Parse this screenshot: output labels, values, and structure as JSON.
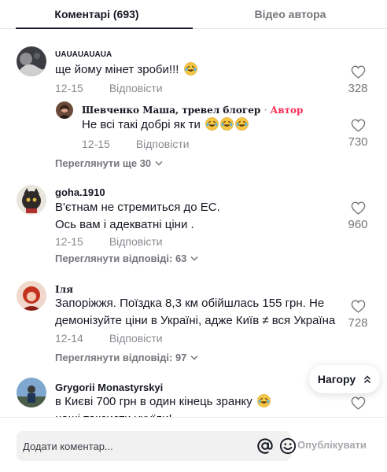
{
  "tabs": [
    {
      "label": "Коментарі (693)",
      "active": true
    },
    {
      "label": "Відео автора",
      "active": false
    }
  ],
  "comments": [
    {
      "user": "UAUAUAUAUA",
      "text": "ще йому мінет зроби!!!",
      "date": "12-15",
      "reply_label": "Відповісти",
      "likes": "328",
      "reply": {
        "user": "Шевченко Маша, тревел блогер",
        "separator": "·",
        "badge": "Автор",
        "text": "Не всі такі добрі як ти",
        "date": "12-15",
        "reply_label": "Відповісти",
        "likes": "730"
      },
      "more_label": "Переглянути ще 30"
    },
    {
      "user": "goha.1910",
      "text_line1": "В'єтнам не стремиться до ЕС.",
      "text_line2": "Ось вам і адекватні ціни .",
      "date": "12-15",
      "reply_label": "Відповісти",
      "likes": "960",
      "more_label": "Переглянути відповіді: 63"
    },
    {
      "user": "Іля",
      "text_line1": "Запоріжжя. Поїздка 8,3 км обійшлась 155 грн. Не",
      "text_line2": "демонізуйте ціни в Україні, адже Київ ≠ вся Україна",
      "date": "12-14",
      "reply_label": "Відповісти",
      "likes": "728",
      "more_label": "Переглянути відповіді: 97"
    },
    {
      "user": "Grygorii Monastyrskyi",
      "text_line1": "в Києві 700 грн в один кінець зранку",
      "text_line2": "наші таксисти ухуїли!"
    }
  ],
  "to_top_label": "Нагору",
  "footer": {
    "placeholder": "Додати коментар...",
    "post_label": "Опублікувати"
  },
  "icons": {
    "like": "heart-outline-icon",
    "more": "chevron-down-icon",
    "to_top": "double-chevron-up-icon",
    "mention": "at-sign-icon",
    "emoji": "smiley-icon",
    "laugh": "laughing-tears-emoji"
  },
  "colors": {
    "text": "#161823",
    "secondary": "#75767c",
    "author_badge": "#fe2c55",
    "input_bg": "#f1f1f2"
  }
}
